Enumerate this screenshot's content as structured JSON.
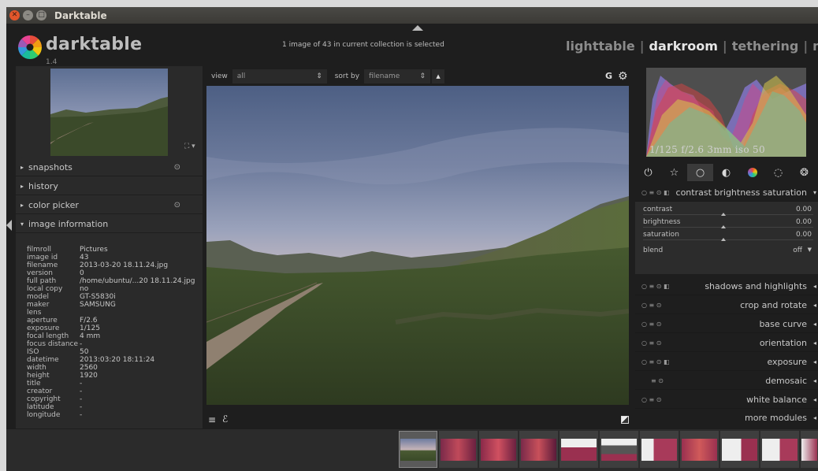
{
  "window": {
    "title": "Darktable"
  },
  "app": {
    "name": "darktable",
    "version": "1.4"
  },
  "status": "1 image of 43 in current collection is selected",
  "views": {
    "lighttable": "lighttable",
    "darkroom": "darkroom",
    "tethering": "tethering",
    "map": "map",
    "separator": "|"
  },
  "toolbar": {
    "view_label": "view",
    "view_value": "all",
    "sort_label": "sort by",
    "sort_value": "filename",
    "group_label": "G"
  },
  "left_modules": {
    "snapshots": "snapshots",
    "history": "history",
    "color_picker": "color picker",
    "image_information": "image information"
  },
  "image_info": [
    {
      "k": "filmroll",
      "v": "Pictures"
    },
    {
      "k": "image id",
      "v": "43"
    },
    {
      "k": "filename",
      "v": "2013-03-20 18.11.24.jpg"
    },
    {
      "k": "version",
      "v": "0"
    },
    {
      "k": "full path",
      "v": "/home/ubuntu/...20 18.11.24.jpg"
    },
    {
      "k": "local copy",
      "v": "no"
    },
    {
      "k": "model",
      "v": "GT-S5830i"
    },
    {
      "k": "maker",
      "v": "SAMSUNG"
    },
    {
      "k": "lens",
      "v": ""
    },
    {
      "k": "aperture",
      "v": "F/2.6"
    },
    {
      "k": "exposure",
      "v": "1/125"
    },
    {
      "k": "focal length",
      "v": "4 mm"
    },
    {
      "k": "focus distance",
      "v": "-"
    },
    {
      "k": "ISO",
      "v": "50"
    },
    {
      "k": "datetime",
      "v": "2013:03:20 18:11:24"
    },
    {
      "k": "width",
      "v": "2560"
    },
    {
      "k": "height",
      "v": "1920"
    },
    {
      "k": "title",
      "v": "-"
    },
    {
      "k": "creator",
      "v": "-"
    },
    {
      "k": "copyright",
      "v": "-"
    },
    {
      "k": "latitude",
      "v": "-"
    },
    {
      "k": "longitude",
      "v": "-"
    }
  ],
  "histogram": {
    "info": "1/125 f/2.6 3mm iso 50"
  },
  "cbs": {
    "title": "contrast brightness saturation",
    "contrast": {
      "label": "contrast",
      "value": "0.00"
    },
    "brightness": {
      "label": "brightness",
      "value": "0.00"
    },
    "saturation": {
      "label": "saturation",
      "value": "0.00"
    },
    "blend_label": "blend",
    "blend_value": "off"
  },
  "modules": {
    "shadows": "shadows and highlights",
    "crop": "crop and rotate",
    "basecurve": "base curve",
    "orientation": "orientation",
    "exposure": "exposure",
    "demosaic": "demosaic",
    "whitebalance": "white balance",
    "more": "more modules"
  },
  "colors": {
    "background": "#1e1e1e",
    "panel": "#2a2a2a",
    "text": "#c8c8c8",
    "titlebar": "#3c3b37",
    "close": "#e2562b"
  }
}
